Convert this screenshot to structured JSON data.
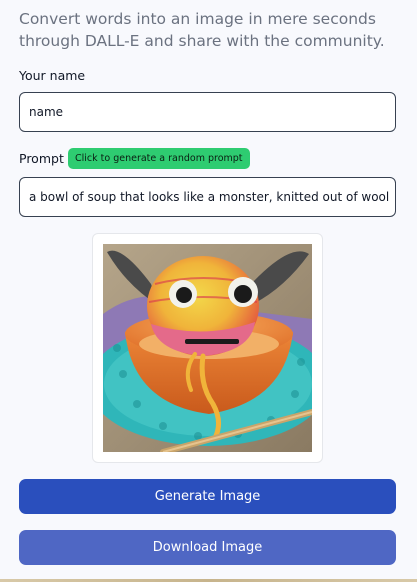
{
  "intro": {
    "text": "Convert words into an image in mere seconds through DALL-E and share with the community."
  },
  "form": {
    "name_label": "Your name",
    "name_value": "name",
    "prompt_label": "Prompt",
    "random_prompt_button": "Click to generate a random prompt",
    "prompt_value": "a bowl of soup that looks like a monster, knitted out of wool"
  },
  "preview": {
    "image_alt": "a bowl of soup that looks like a monster, knitted out of wool"
  },
  "actions": {
    "generate_label": "Generate Image",
    "download_label": "Download Image"
  },
  "colors": {
    "generate_button": "#2a4fbd",
    "download_button": "#4f67c4",
    "random_prompt_badge": "#2ecc71"
  }
}
